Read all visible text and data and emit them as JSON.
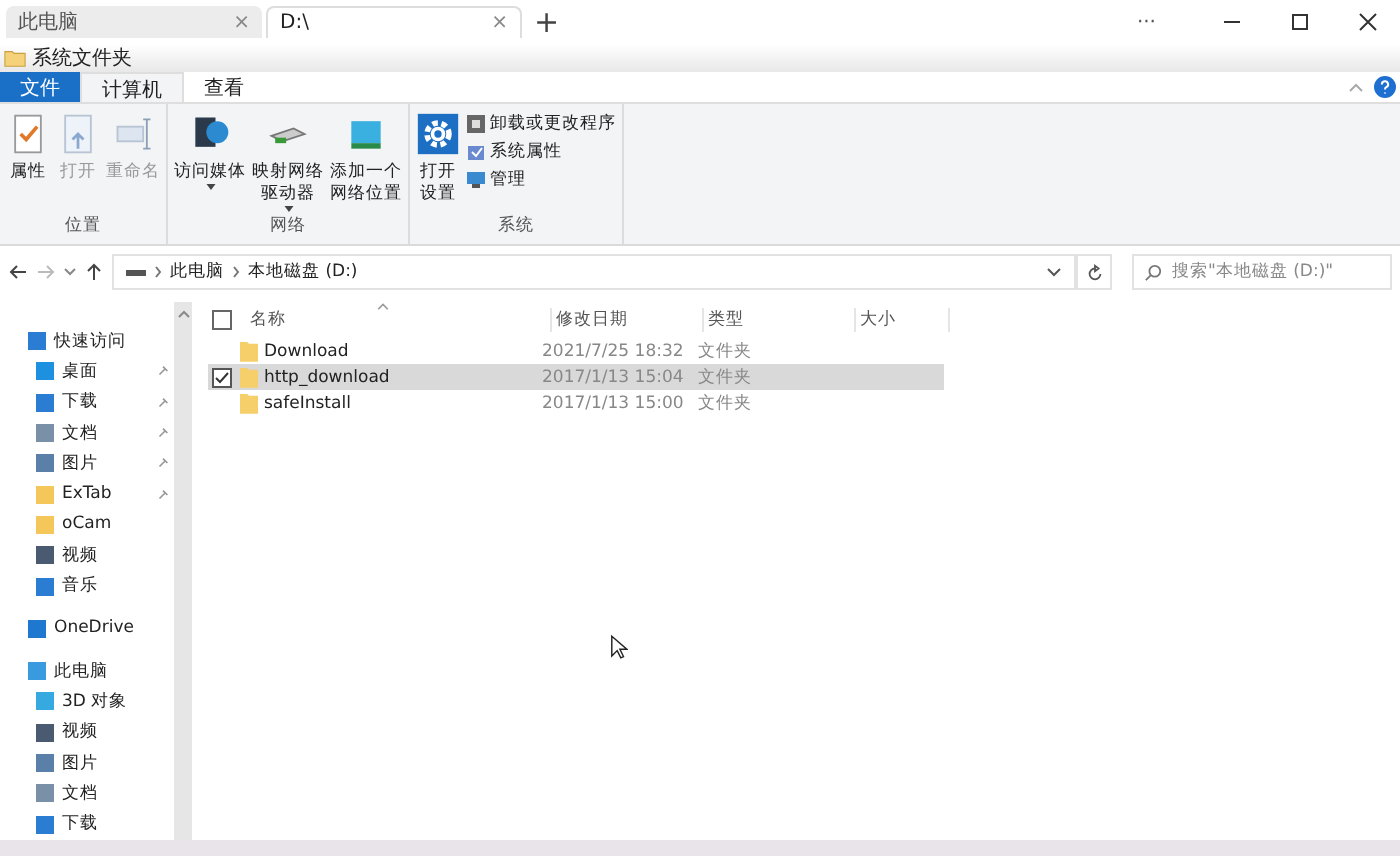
{
  "tabs": [
    {
      "label": "此电脑",
      "close": "×",
      "selected": false
    },
    {
      "label": "D:\\",
      "close": "×",
      "selected": true
    }
  ],
  "new_tab": "+",
  "window_controls": {
    "more": "···"
  },
  "quick_access_toolbar": {
    "title": "系统文件夹"
  },
  "ribbon_tabs": [
    {
      "label": "文件",
      "kind": "file"
    },
    {
      "label": "计算机",
      "kind": "tab",
      "selected": true
    },
    {
      "label": "查看",
      "kind": "tab",
      "selected": false
    }
  ],
  "ribbon_groups": [
    {
      "label": "位置",
      "commands": [
        {
          "lines": [
            "属性"
          ],
          "kind": "large",
          "disabled": false
        },
        {
          "lines": [
            "打开"
          ],
          "kind": "large",
          "disabled": true
        },
        {
          "lines": [
            "重命名"
          ],
          "kind": "large",
          "disabled": true
        }
      ]
    },
    {
      "label": "网络",
      "commands": [
        {
          "lines": [
            "访问媒体"
          ],
          "kind": "large",
          "dropdown": true,
          "disabled": false
        },
        {
          "lines": [
            "映射网络",
            "驱动器"
          ],
          "kind": "large",
          "dropdown": true,
          "disabled": false
        },
        {
          "lines": [
            "添加一个",
            "网络位置"
          ],
          "kind": "large",
          "dropdown": false,
          "disabled": false
        }
      ]
    },
    {
      "label": "系统",
      "commands": [
        {
          "lines": [
            "打开",
            "设置"
          ],
          "kind": "large",
          "disabled": false
        },
        {
          "lines": [
            "卸载或更改程序"
          ],
          "kind": "small",
          "disabled": false
        },
        {
          "lines": [
            "系统属性"
          ],
          "kind": "small",
          "disabled": false
        },
        {
          "lines": [
            "管理"
          ],
          "kind": "small",
          "disabled": false
        }
      ]
    }
  ],
  "breadcrumb": [
    "此电脑",
    "本地磁盘 (D:)"
  ],
  "search": {
    "placeholder": "搜索\"本地磁盘 (D:)\""
  },
  "nav": [
    {
      "label": "快速访问",
      "children": [
        {
          "label": "桌面",
          "pinned": true
        },
        {
          "label": "下载",
          "pinned": true
        },
        {
          "label": "文档",
          "pinned": true
        },
        {
          "label": "图片",
          "pinned": true
        },
        {
          "label": "ExTab",
          "pinned": true
        },
        {
          "label": "oCam",
          "pinned": false
        },
        {
          "label": "视频",
          "pinned": false
        },
        {
          "label": "音乐",
          "pinned": false
        }
      ]
    },
    {
      "label": "OneDrive"
    },
    {
      "label": "此电脑",
      "children": [
        {
          "label": "3D 对象",
          "pinned": false
        },
        {
          "label": "视频",
          "pinned": false
        },
        {
          "label": "图片",
          "pinned": false
        },
        {
          "label": "文档",
          "pinned": false
        },
        {
          "label": "下载",
          "pinned": false
        }
      ]
    }
  ],
  "table": {
    "select_all": {
      "checked": false
    },
    "columns": [
      "名称",
      "修改日期",
      "类型",
      "大小"
    ],
    "rows": [
      {
        "name": "Download",
        "modified": "2021/7/25 18:32",
        "type": "文件夹",
        "selected": false,
        "checked": false
      },
      {
        "name": "http_download",
        "modified": "2017/1/13 15:04",
        "type": "文件夹",
        "selected": true,
        "checked": true
      },
      {
        "name": "safeInstall",
        "modified": "2017/1/13 15:00",
        "type": "文件夹",
        "selected": false,
        "checked": false
      }
    ]
  }
}
